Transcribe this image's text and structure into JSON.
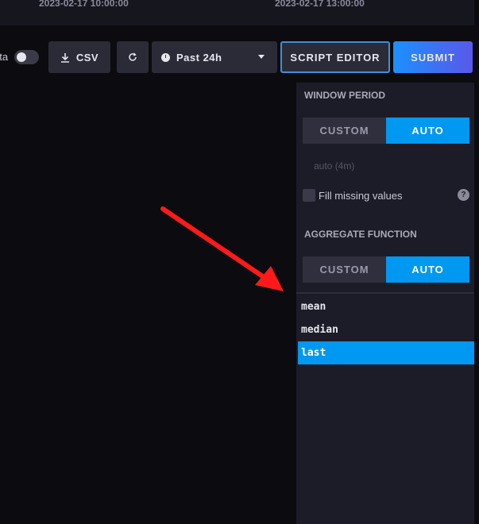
{
  "timeline": {
    "ticks": [
      "2023-02-17 10:00:00",
      "2023-02-17 13:00:00"
    ]
  },
  "toolbar": {
    "raw_data_toggle_label": "ata",
    "csv_label": "CSV",
    "time_range_label": "Past 24h",
    "script_editor_label": "SCRIPT EDITOR",
    "submit_label": "SUBMIT"
  },
  "window_period": {
    "title": "WINDOW PERIOD",
    "custom_label": "CUSTOM",
    "auto_label": "AUTO",
    "selected": "AUTO",
    "auto_value": "auto (4m)",
    "fill_missing_label": "Fill missing values",
    "help_label": "?"
  },
  "aggregate_function": {
    "title": "AGGREGATE FUNCTION",
    "custom_label": "CUSTOM",
    "auto_label": "AUTO",
    "selected": "AUTO",
    "functions": [
      "mean",
      "median",
      "last"
    ],
    "selected_function": "last"
  },
  "colors": {
    "accent": "#0098f0",
    "annotation_arrow": "#ff1a1a"
  },
  "icons": {
    "csv": "download-icon",
    "refresh": "refresh-icon",
    "time": "clock-icon",
    "caret": "caret-down-icon"
  }
}
